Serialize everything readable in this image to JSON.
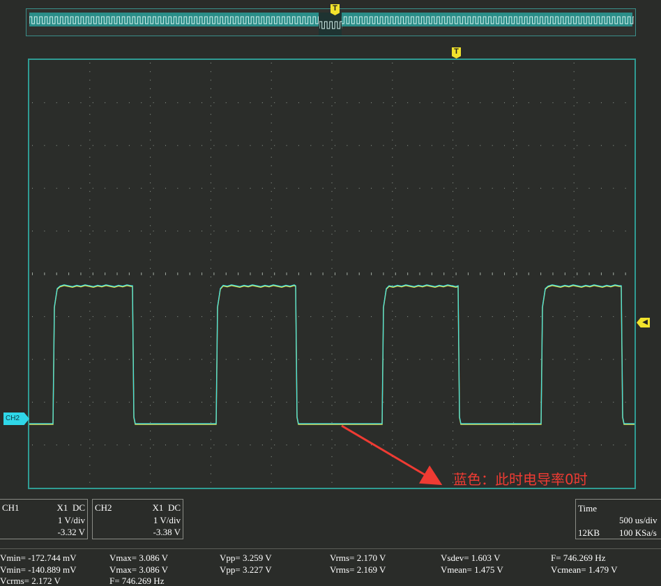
{
  "overview": {
    "trigger_marker": "T"
  },
  "screen": {
    "trigger_marker": "T",
    "ch2_marker": "CH2",
    "trigger_level_marker": "◀"
  },
  "annotation": {
    "text": "蓝色：此时电导率0时"
  },
  "ch1_panel": {
    "name": "CH1",
    "probe": "X1",
    "coupling": "DC",
    "scale": "1 V/div",
    "offset": "-3.32 V"
  },
  "ch2_panel": {
    "name": "CH2",
    "probe": "X1",
    "coupling": "DC",
    "scale": "1 V/div",
    "offset": "-3.38 V"
  },
  "time_panel": {
    "label": "Time",
    "timebase": "500 us/div",
    "memory": "12KB",
    "sample_rate": "100 KSa/s"
  },
  "measurements": {
    "row1": [
      "Vmin= -172.744 mV",
      "Vmax= 3.086 V",
      "Vpp= 3.259 V",
      "Vrms= 2.170 V",
      "Vsdev= 1.603 V",
      "F= 746.269 Hz"
    ],
    "row2": [
      "Vmin= -140.889 mV",
      "Vmax= 3.086 V",
      "Vpp= 3.227 V",
      "Vrms= 2.169 V",
      "Vmean= 1.475 V",
      "Vcmean= 1.479 V"
    ],
    "row3": [
      "Vcrms= 2.172 V",
      "F= 746.269 Hz"
    ]
  },
  "colors": {
    "grid_dot": "#9aa39a",
    "ch1_trace": "#e6e24a",
    "ch2_trace": "#3fe0e6",
    "border": "#2f9c93",
    "annotation": "#ef3b33"
  },
  "chart_data": {
    "type": "line",
    "series": [
      {
        "name": "CH1",
        "high_v": 3.086,
        "low_v": -0.173
      },
      {
        "name": "CH2",
        "high_v": 3.086,
        "low_v": -0.141
      }
    ],
    "frequency_hz": 746.269,
    "timebase": "500 us/div",
    "volts_per_div": "1 V/div",
    "grid": true
  }
}
